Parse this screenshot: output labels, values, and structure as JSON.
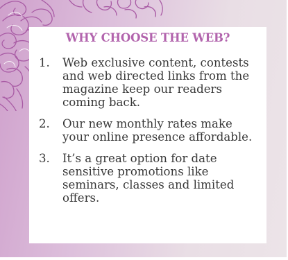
{
  "heading": "WHY CHOOSE THE WEB?",
  "reasons": [
    {
      "number": "1.",
      "text": "Web exclusive content, contests and web directed links from the magazine keep our readers coming back."
    },
    {
      "number": "2.",
      "text": "Our new monthly rates make your online presence affordable."
    },
    {
      "number": "3.",
      "text": "It’s a great option for date sensitive promotions like seminars, classes and limited offers."
    }
  ],
  "colors": {
    "heading": "#b264ad",
    "body_text": "#383838",
    "background_left": "#cfa0cc",
    "background_right": "#ece4e8",
    "floral_line": "#a85aa4",
    "card": "#ffffff"
  },
  "decoration": "floral-illustration"
}
